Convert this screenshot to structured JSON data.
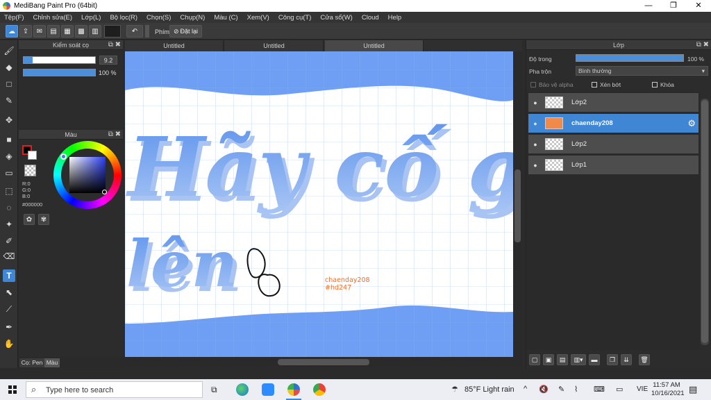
{
  "window": {
    "title": "MediBang Paint Pro (64bit)",
    "controls": {
      "minimize": "—",
      "maximize": "❐",
      "close": "✕"
    }
  },
  "menu": [
    "Tệp(F)",
    "Chỉnh sửa(E)",
    "Lớp(L)",
    "Bộ lọc(R)",
    "Chọn(S)",
    "Chụp(N)",
    "Màu (C)",
    "Xem(V)",
    "Công cụ(T)",
    "Cửa sổ(W)",
    "Cloud",
    "Help"
  ],
  "toolbar": {
    "undo_icon": "undo-arrow-icon",
    "shortcut_label": "Phím",
    "reset_label": "Đặt lại"
  },
  "brush_control": {
    "title": "Kiểm soát cọ",
    "size_value": "9.2",
    "size_fill": 0.13,
    "opacity_value": "100 %",
    "opacity_fill": 1.0
  },
  "color_panel": {
    "title": "Màu",
    "foreground": "#000000",
    "rgb": {
      "r": "R:0",
      "g": "G:0",
      "b": "B:0"
    },
    "hex": "#000000"
  },
  "left_tabs": {
    "pen": "Cọ: Pen",
    "color": "Màu"
  },
  "canvas": {
    "tabs": [
      "Untitled",
      "Untitled",
      "Untitled"
    ],
    "active_tab": 2,
    "bg_color": "#6e9ff5",
    "lettering_line1": "Hãy cố gắng",
    "lettering_line2": "lên",
    "watermark_line1": "chaenday208",
    "watermark_line2": "#hd247"
  },
  "layers_panel": {
    "title": "Lớp",
    "opacity_label": "Độ trong",
    "opacity_value": "100 %",
    "blend_label": "Pha trộn",
    "blend_value": "Bình thường",
    "protect_alpha": "Bảo vệ alpha",
    "clipping": "Xén bớt",
    "lock": "Khóa",
    "layers": [
      {
        "name": "Lớp2",
        "selected": false
      },
      {
        "name": "chaenday208",
        "selected": true
      },
      {
        "name": "Lớp2",
        "selected": false
      },
      {
        "name": "Lớp1",
        "selected": false
      }
    ]
  },
  "taskbar": {
    "search_placeholder": "Type here to search",
    "weather": "85°F  Light rain",
    "lang": "VIE",
    "time": "11:57 AM",
    "date": "10/16/2021"
  }
}
